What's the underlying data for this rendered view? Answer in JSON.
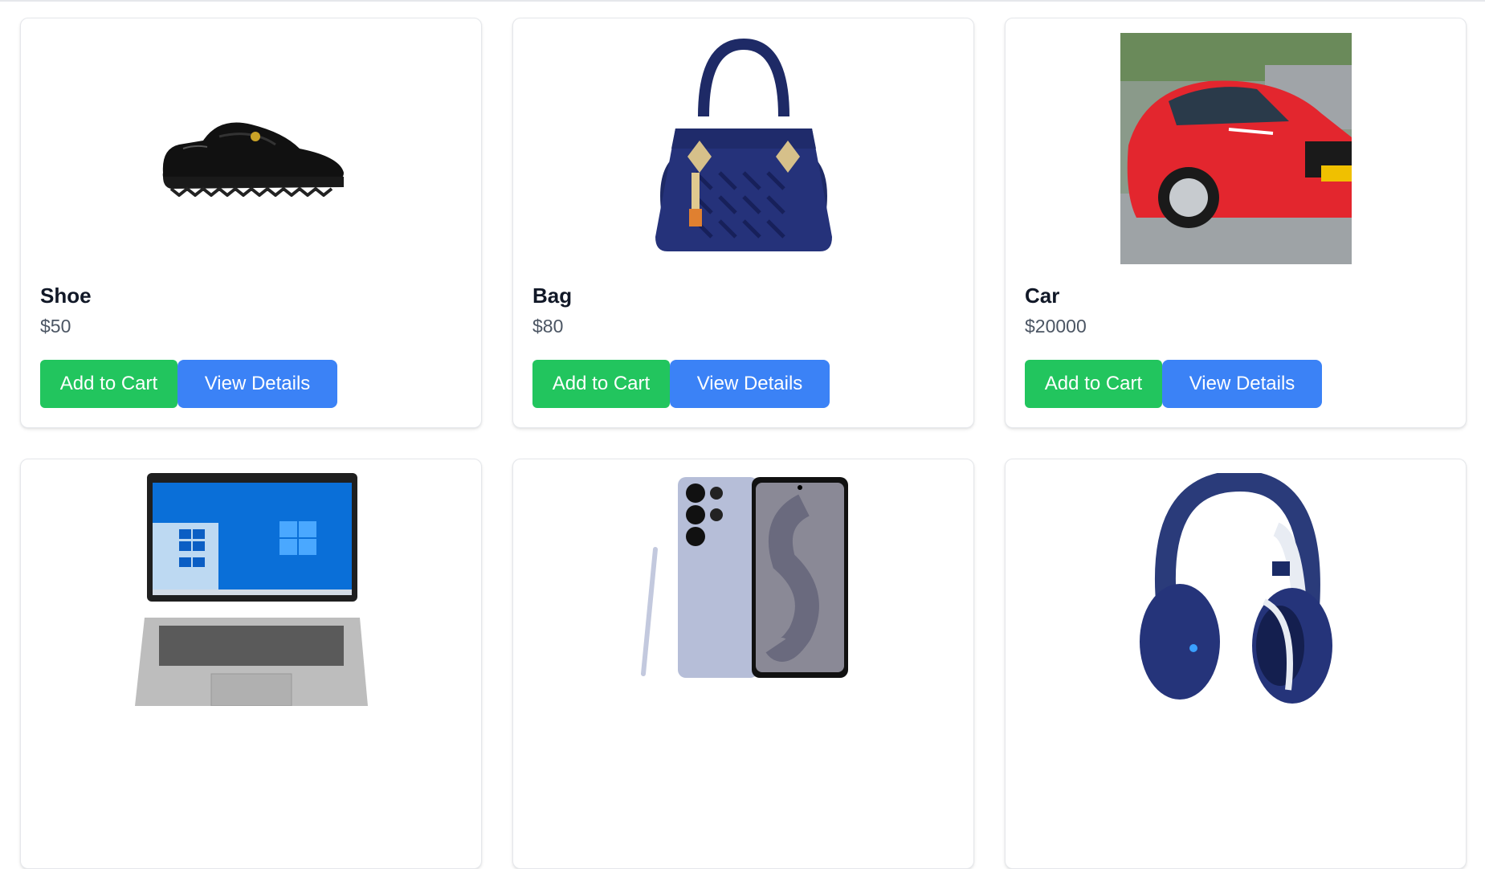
{
  "products": [
    {
      "name": "Shoe",
      "price": "$50",
      "add_to_cart": "Add to Cart",
      "view_details": "View Details"
    },
    {
      "name": "Bag",
      "price": "$80",
      "add_to_cart": "Add to Cart",
      "view_details": "View Details"
    },
    {
      "name": "Car",
      "price": "$20000",
      "add_to_cart": "Add to Cart",
      "view_details": "View Details"
    },
    {
      "name": "",
      "price": "",
      "add_to_cart": "",
      "view_details": ""
    },
    {
      "name": "",
      "price": "",
      "add_to_cart": "",
      "view_details": ""
    },
    {
      "name": "",
      "price": "",
      "add_to_cart": "",
      "view_details": ""
    }
  ],
  "colors": {
    "add_to_cart": "#22c55e",
    "view_details": "#3b82f6"
  }
}
